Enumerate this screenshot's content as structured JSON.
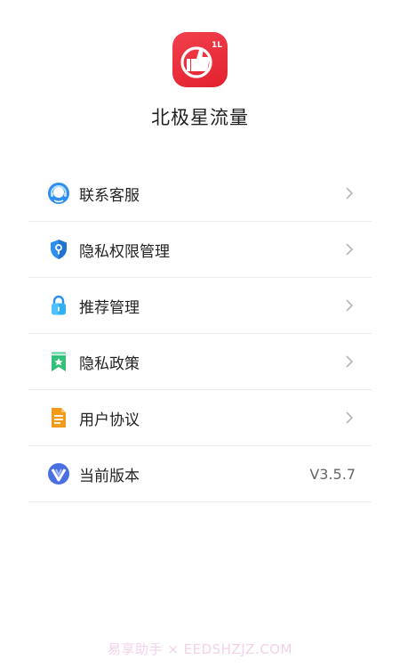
{
  "app": {
    "title": "北极星流量",
    "logo_icon": "thumbs-up-logo"
  },
  "menu": {
    "items": [
      {
        "label": "联系客服",
        "icon": "customer-service-icon"
      },
      {
        "label": "隐私权限管理",
        "icon": "privacy-shield-icon"
      },
      {
        "label": "推荐管理",
        "icon": "lock-icon"
      },
      {
        "label": "隐私政策",
        "icon": "bookmark-star-icon"
      },
      {
        "label": "用户协议",
        "icon": "document-icon"
      },
      {
        "label": "当前版本",
        "icon": "version-icon",
        "value": "V3.5.7"
      }
    ]
  },
  "watermark": "易享助手 × EEDSHZJZ.COM",
  "colors": {
    "logo_red": "#e3212f",
    "icon_blue": "#2f8ff0",
    "icon_green": "#33c07a",
    "icon_orange": "#f29b1a",
    "text_primary": "#222222",
    "text_secondary": "#666666",
    "divider": "#ececec"
  }
}
